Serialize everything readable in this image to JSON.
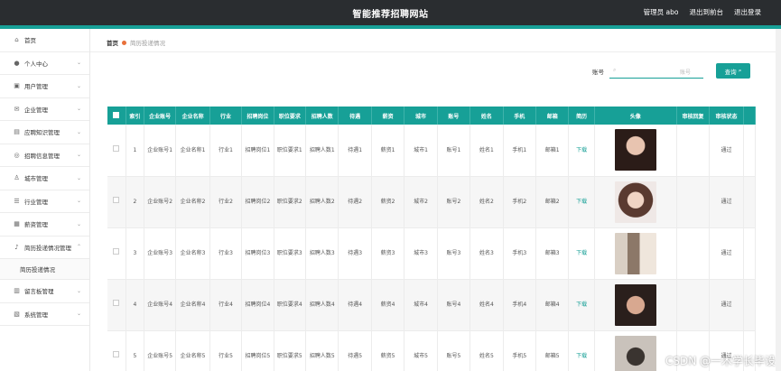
{
  "header": {
    "title": "智能推荐招聘网站",
    "admin": "管理员 abo",
    "back_home": "退出到前台",
    "logout": "退出登录"
  },
  "sidebar": {
    "items": [
      {
        "icon": "home-icon",
        "label": "首页",
        "chev": false
      },
      {
        "icon": "user-icon",
        "label": "个人中心",
        "chev": true
      },
      {
        "icon": "users-icon",
        "label": "用户管理",
        "chev": true
      },
      {
        "icon": "mail-icon",
        "label": "企业管理",
        "chev": true
      },
      {
        "icon": "book-icon",
        "label": "应聘知识管理",
        "chev": true
      },
      {
        "icon": "globe-icon",
        "label": "招聘信息管理",
        "chev": true
      },
      {
        "icon": "person-icon",
        "label": "城市管理",
        "chev": true
      },
      {
        "icon": "list-icon",
        "label": "行业管理",
        "chev": true
      },
      {
        "icon": "grid-icon",
        "label": "薪资管理",
        "chev": true
      },
      {
        "icon": "mic-icon",
        "label": "简历投递情况管理",
        "chev": true,
        "expanded": true
      }
    ],
    "sub": "简历投递情况",
    "items_after": [
      {
        "icon": "board-icon",
        "label": "留言板管理",
        "chev": true
      },
      {
        "icon": "system-icon",
        "label": "系统管理",
        "chev": true
      }
    ]
  },
  "breadcrumb": {
    "home": "首页",
    "current": "简历投递情况"
  },
  "search": {
    "label": "账号",
    "placeholder": "账号",
    "button": "查询"
  },
  "table": {
    "headers": [
      "索引",
      "企业账号",
      "企业名称",
      "行业",
      "招聘岗位",
      "职位要求",
      "招聘人数",
      "待遇",
      "薪资",
      "城市",
      "账号",
      "姓名",
      "手机",
      "邮箱",
      "简历",
      "头像",
      "审核回复",
      "审核状态"
    ],
    "rows": [
      {
        "idx": "1",
        "acct": "企业账号1",
        "name": "企业名称1",
        "ind": "行业1",
        "post": "招聘岗位1",
        "req": "职位要求1",
        "num": "招聘人数1",
        "treat": "待遇1",
        "sal": "薪资1",
        "city": "城市1",
        "user": "账号1",
        "xm": "姓名1",
        "phone": "手机1",
        "email": "邮箱1",
        "resume": "下载",
        "reply": "",
        "status": "通过"
      },
      {
        "idx": "2",
        "acct": "企业账号2",
        "name": "企业名称2",
        "ind": "行业2",
        "post": "招聘岗位2",
        "req": "职位要求2",
        "num": "招聘人数2",
        "treat": "待遇2",
        "sal": "薪资2",
        "city": "城市2",
        "user": "账号2",
        "xm": "姓名2",
        "phone": "手机2",
        "email": "邮箱2",
        "resume": "下载",
        "reply": "",
        "status": "通过"
      },
      {
        "idx": "3",
        "acct": "企业账号3",
        "name": "企业名称3",
        "ind": "行业3",
        "post": "招聘岗位3",
        "req": "职位要求3",
        "num": "招聘人数3",
        "treat": "待遇3",
        "sal": "薪资3",
        "city": "城市3",
        "user": "账号3",
        "xm": "姓名3",
        "phone": "手机3",
        "email": "邮箱3",
        "resume": "下载",
        "reply": "",
        "status": "通过"
      },
      {
        "idx": "4",
        "acct": "企业账号4",
        "name": "企业名称4",
        "ind": "行业4",
        "post": "招聘岗位4",
        "req": "职位要求4",
        "num": "招聘人数4",
        "treat": "待遇4",
        "sal": "薪资4",
        "city": "城市4",
        "user": "账号4",
        "xm": "姓名4",
        "phone": "手机4",
        "email": "邮箱4",
        "resume": "下载",
        "reply": "",
        "status": "通过"
      },
      {
        "idx": "5",
        "acct": "企业账号5",
        "name": "企业名称5",
        "ind": "行业5",
        "post": "招聘岗位5",
        "req": "职位要求5",
        "num": "招聘人数5",
        "treat": "待遇5",
        "sal": "薪资5",
        "city": "城市5",
        "user": "账号5",
        "xm": "姓名5",
        "phone": "手机5",
        "email": "邮箱5",
        "resume": "下载",
        "reply": "",
        "status": "通过"
      }
    ]
  },
  "watermark": "CSDN @一木学长毕设",
  "colors": {
    "accent": "#17a097",
    "topbar": "#2a2d30"
  }
}
